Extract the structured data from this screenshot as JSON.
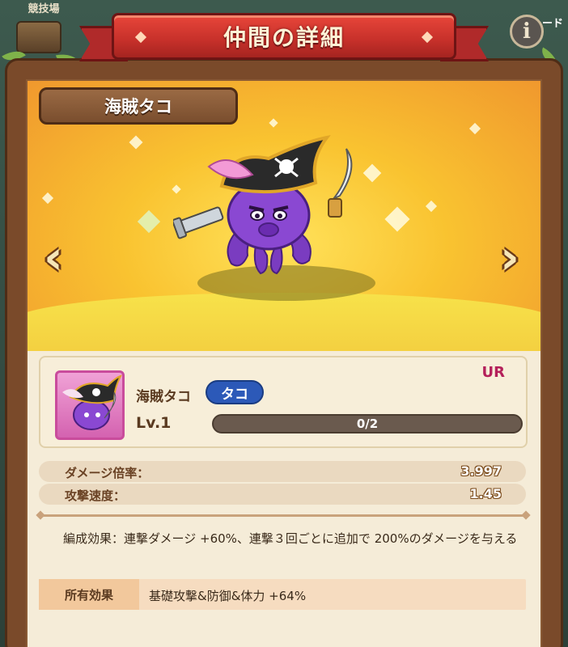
{
  "header": {
    "title": "仲間の詳細",
    "top_left_label": "競技場",
    "top_right_label": "ード",
    "info_icon": "info-icon"
  },
  "character": {
    "name": "海賊タコ"
  },
  "navigation": {
    "prev_icon": "chevron-left-icon",
    "next_icon": "chevron-right-icon",
    "prev_glyph": "‹",
    "next_glyph": "›"
  },
  "unit": {
    "rarity": "UR",
    "name": "海賊タコ",
    "type_badge": "タコ",
    "level": "Lv.1",
    "exp_text": "0/2",
    "exp_progress": 0
  },
  "stats": [
    {
      "label": "ダメージ倍率：",
      "value": "3.997"
    },
    {
      "label": "攻撃速度：",
      "value": "1.45"
    }
  ],
  "effects": {
    "formation_text": "編成効果：連撃ダメージ +60%、連撃３回ごとに追加で 200%のダメージを与える",
    "owned_label": "所有効果",
    "owned_value": "基礎攻撃&防御&体力 +64%"
  },
  "colors": {
    "ribbon": "#c6302a",
    "frame": "#7a4a2a",
    "rarity": "#b4205a",
    "type_badge": "#2c59b8",
    "octopus": "#7a3cc0"
  }
}
